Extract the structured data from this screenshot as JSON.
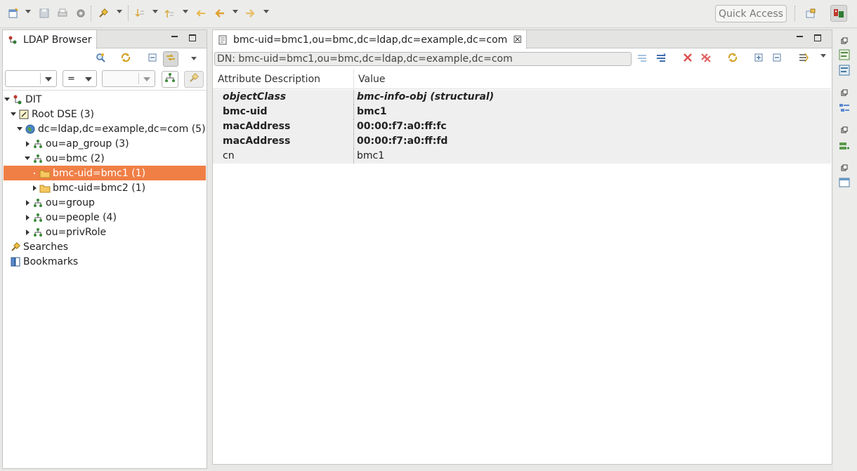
{
  "toolbar": {
    "quick_access_label": "Quick Access"
  },
  "ldap_browser": {
    "tab_label": "LDAP Browser",
    "filter": {
      "attribute_value": "",
      "operator_value": "=",
      "value_value": ""
    },
    "tree": {
      "dit": "DIT",
      "root_dse": "Root DSE (3)",
      "base_dn": "dc=ldap,dc=example,dc=com (5)",
      "ap_group": "ou=ap_group (3)",
      "bmc": "ou=bmc (2)",
      "bmc1": "bmc-uid=bmc1 (1)",
      "bmc2": "bmc-uid=bmc2 (1)",
      "group": "ou=group",
      "people": "ou=people (4)",
      "privrole": "ou=privRole",
      "searches": "Searches",
      "bookmarks": "Bookmarks"
    }
  },
  "entry_editor": {
    "tab_label": "bmc-uid=bmc1,ou=bmc,dc=ldap,dc=example,dc=com",
    "dn_label": "DN: bmc-uid=bmc1,ou=bmc,dc=ldap,dc=example,dc=com",
    "columns": {
      "attribute": "Attribute Description",
      "value": "Value"
    },
    "rows": [
      {
        "attribute": "objectClass",
        "value": "bmc-info-obj (structural)"
      },
      {
        "attribute": "bmc-uid",
        "value": "bmc1"
      },
      {
        "attribute": "macAddress",
        "value": "00:00:f7:a0:ff:fc"
      },
      {
        "attribute": "macAddress",
        "value": "00:00:f7:a0:ff:fd"
      },
      {
        "attribute": "cn",
        "value": "bmc1"
      }
    ]
  },
  "colors": {
    "selection": "#f07f46",
    "background": "#e8e8e7"
  }
}
